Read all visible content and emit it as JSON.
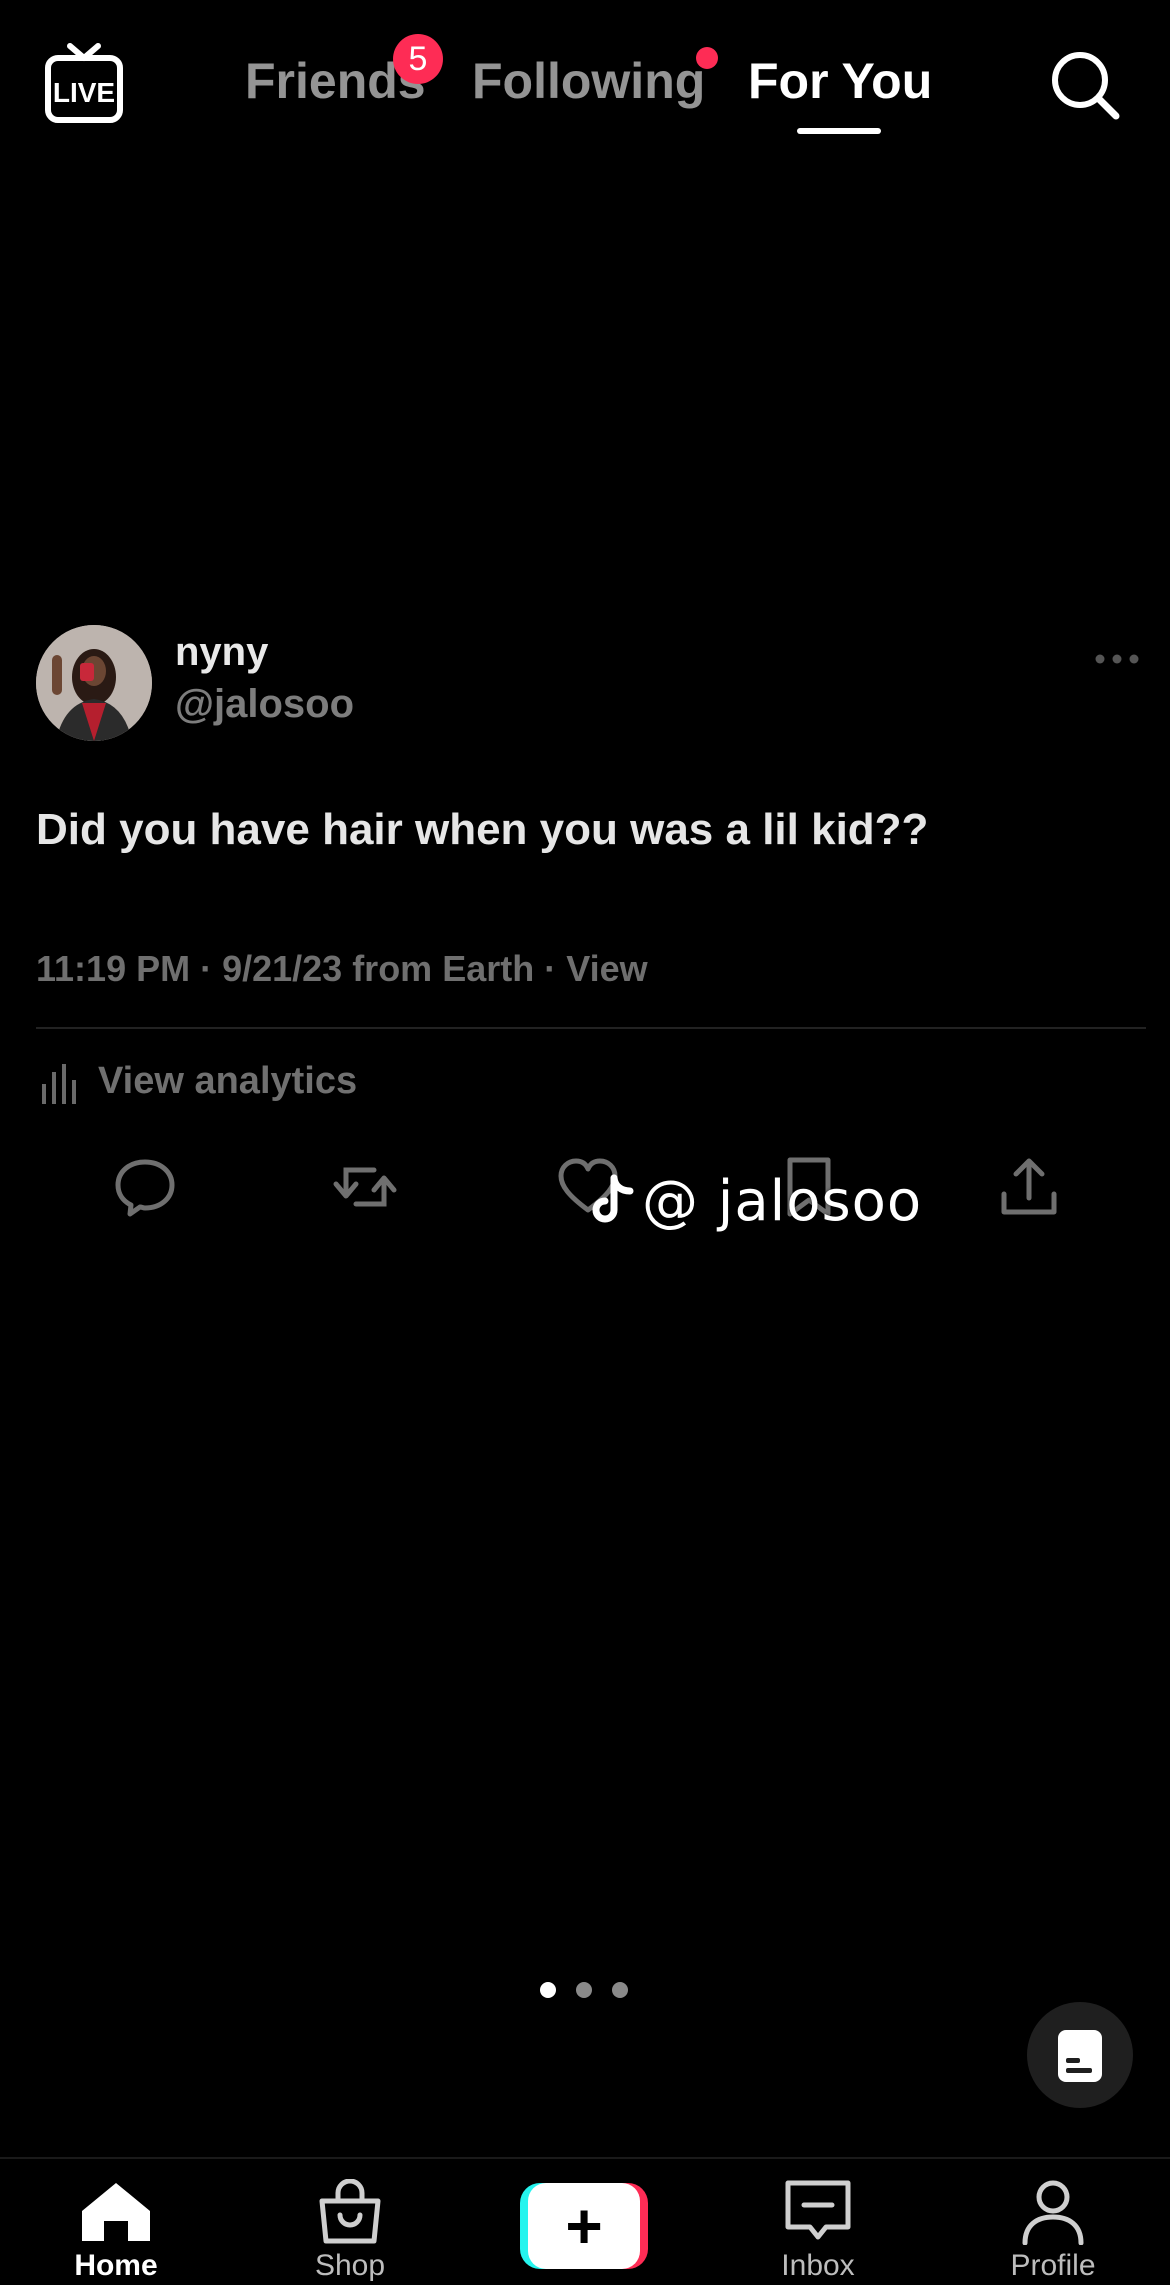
{
  "topnav": {
    "live_label": "LIVE",
    "tabs": [
      {
        "label": "Friends",
        "badge": "5"
      },
      {
        "label": "Following"
      },
      {
        "label": "For You",
        "active": true
      }
    ]
  },
  "post": {
    "display_name": "nyny",
    "handle": "@jalosoo",
    "text": "Did you have hair when you was a lil kid??",
    "meta": "11:19 PM · 9/21/23 from Earth · View",
    "analytics_label": "View analytics",
    "watermark": "@ jalosoo"
  },
  "pager": {
    "count": 3,
    "active_index": 0
  },
  "bottomnav": {
    "items": [
      {
        "label": "Home",
        "icon": "home-icon",
        "active": true
      },
      {
        "label": "Shop",
        "icon": "shop-bag-icon"
      },
      {
        "label": "",
        "icon": "plus-icon"
      },
      {
        "label": "Inbox",
        "icon": "inbox-icon"
      },
      {
        "label": "Profile",
        "icon": "profile-icon"
      }
    ]
  },
  "colors": {
    "background": "#000000",
    "badge_red": "#fe2c55",
    "create_cyan": "#25f4ee",
    "create_pink": "#fe2c55"
  }
}
